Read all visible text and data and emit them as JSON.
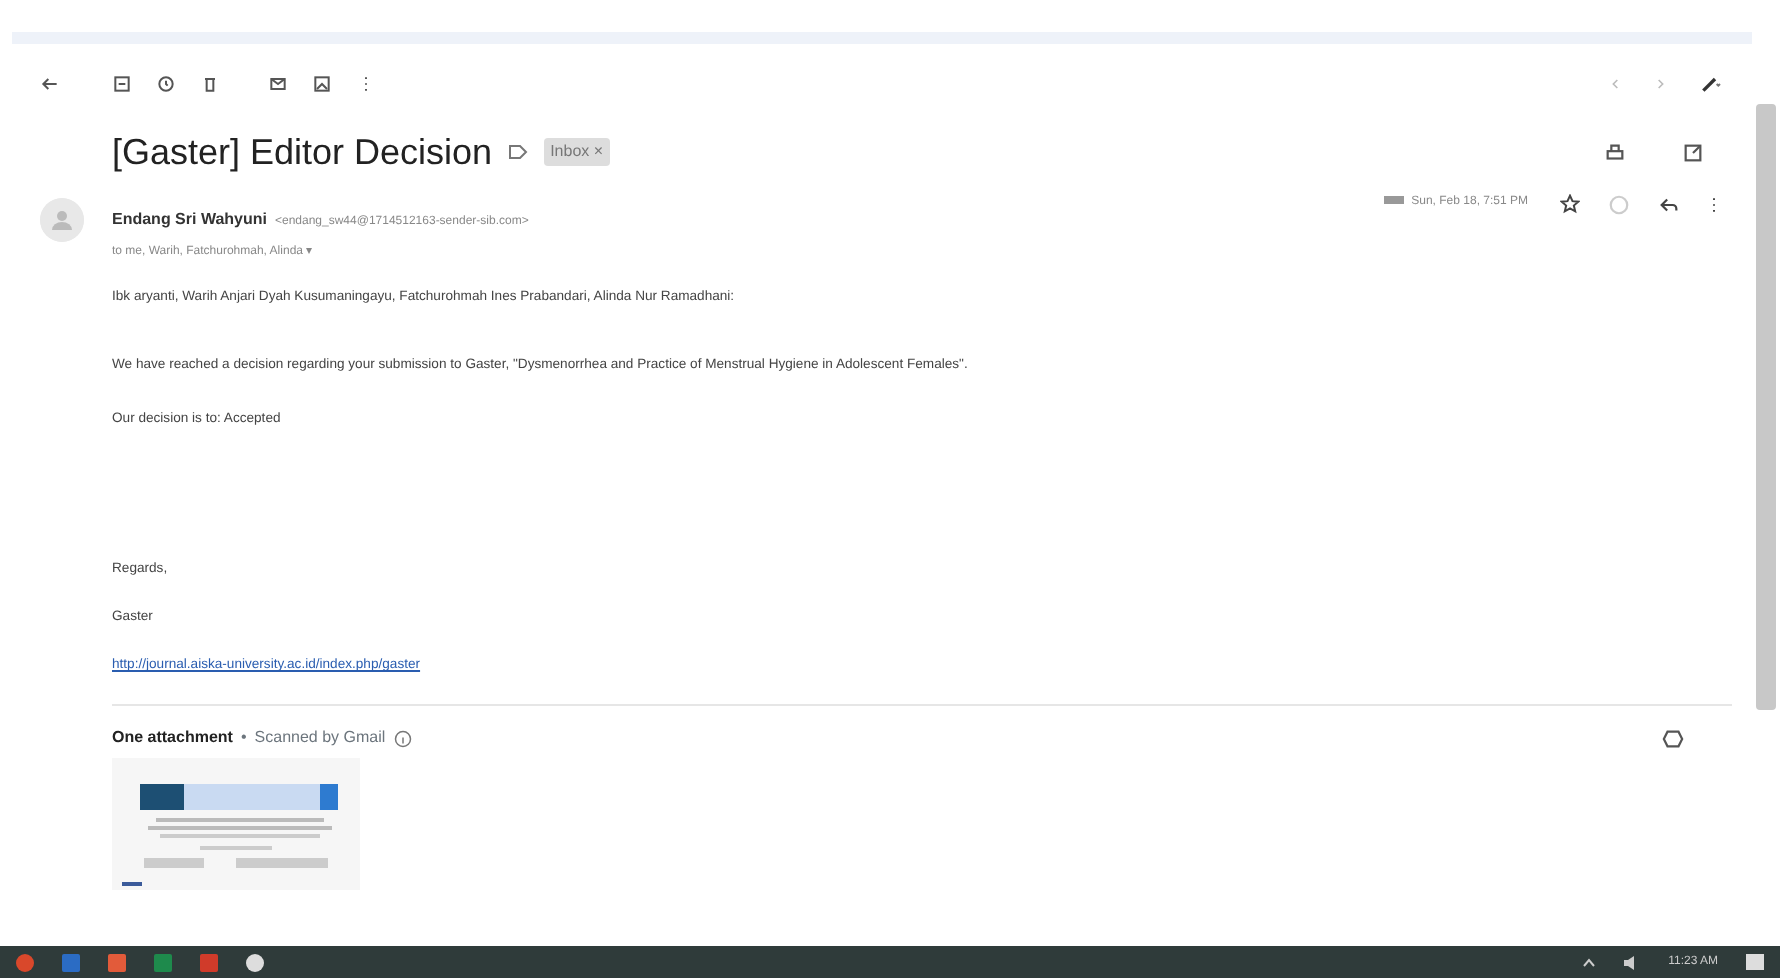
{
  "subject": "[Gaster] Editor Decision",
  "labels": [
    {
      "text": "Inbox",
      "remove": "×"
    }
  ],
  "message": {
    "sender_name": "Endang Sri Wahyuni",
    "sender_email": "<endang_sw44@1714512163-sender-sib.com>",
    "recipients": "to me, Warih, Fatchurohmah, Alinda",
    "recipients_caret": "▾",
    "date": "Sun, Feb 18, 7:51 PM",
    "starred": false
  },
  "body": {
    "paragraphs": [
      "Ibk aryanti, Warih Anjari Dyah Kusumaningayu, Fatchurohmah Ines Prabandari, Alinda Nur Ramadhani:",
      "We have reached a decision regarding your submission to Gaster, \"Dysmenorrhea and Practice of Menstrual Hygiene in Adolescent Females\".",
      "Our decision is to: Accepted"
    ],
    "signature": [
      "Regards,",
      "Gaster"
    ],
    "link": "http://journal.aiska-university.ac.id/index.php/gaster"
  },
  "attachments": {
    "title": "One attachment",
    "separator": "•",
    "scan_note": "Scanned by Gmail"
  },
  "taskbar": {
    "clock": "11:23 AM"
  }
}
